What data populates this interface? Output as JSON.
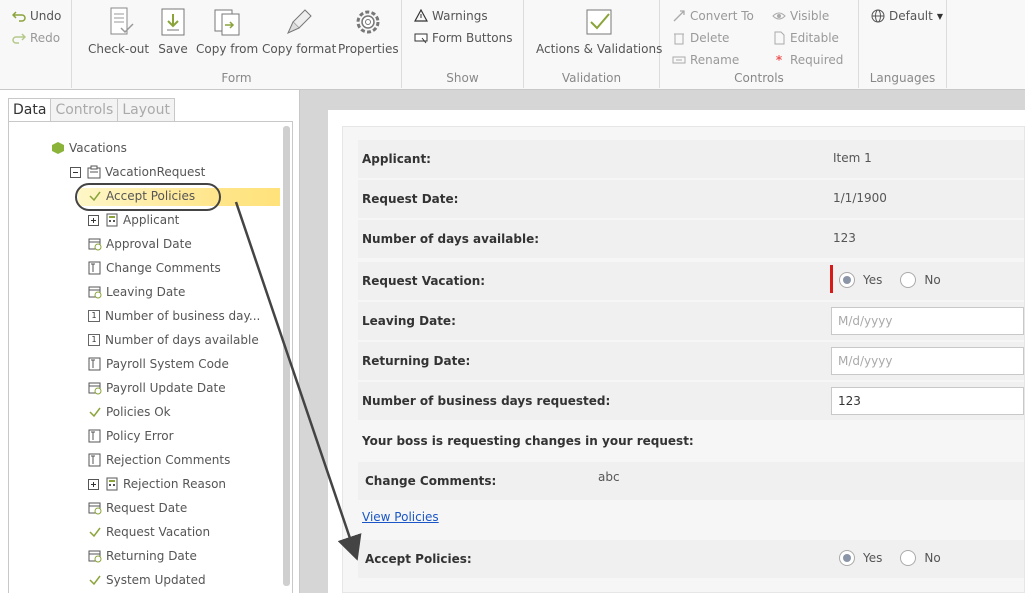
{
  "ribbon": {
    "undo_label": "Undo",
    "redo_label": "Redo",
    "form": {
      "label": "Form",
      "checkout_label": "Check-out",
      "save_label": "Save",
      "copy_from_label": "Copy from",
      "copy_format_label": "Copy format",
      "properties_label": "Properties"
    },
    "show": {
      "label": "Show",
      "warnings_label": "Warnings",
      "form_buttons_label": "Form Buttons"
    },
    "validation": {
      "label": "Validation",
      "actions_validations_label": "Actions & Validations"
    },
    "controls": {
      "label": "Controls",
      "convert_to_label": "Convert To",
      "delete_label": "Delete",
      "rename_label": "Rename",
      "visible_label": "Visible",
      "editable_label": "Editable",
      "required_label": "Required"
    },
    "languages": {
      "label": "Languages",
      "default_label": "Default"
    }
  },
  "panel": {
    "tabs": [
      "Data",
      "Controls",
      "Layout"
    ],
    "tree": {
      "root": "Vacations",
      "entity": "VacationRequest",
      "items": [
        "Accept Policies",
        "Applicant",
        "Approval Date",
        "Change Comments",
        "Leaving Date",
        "Number of business day...",
        "Number of days available",
        "Payroll System Code",
        "Payroll Update Date",
        "Policies Ok",
        "Policy Error",
        "Rejection Comments",
        "Rejection Reason",
        "Request Date",
        "Request Vacation",
        "Returning Date",
        "System Updated"
      ]
    }
  },
  "form": {
    "applicant_label": "Applicant:",
    "applicant_value": "Item 1",
    "request_date_label": "Request Date:",
    "request_date_value": "1/1/1900",
    "days_available_label": "Number of days available:",
    "days_available_value": "123",
    "request_vacation_label": "Request Vacation:",
    "yes_label": "Yes",
    "no_label": "No",
    "leaving_date_label": "Leaving Date:",
    "date_placeholder": "M/d/yyyy",
    "returning_date_label": "Returning Date:",
    "business_days_label": "Number of business days requested:",
    "business_days_value": "123",
    "boss_message": "Your boss is requesting changes in your request:",
    "change_comments_label": "Change Comments:",
    "change_comments_value": "abc",
    "view_policies_link": "View Policies",
    "accept_policies_label": "Accept Policies:"
  }
}
